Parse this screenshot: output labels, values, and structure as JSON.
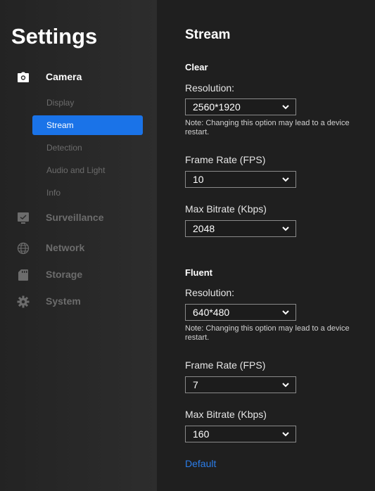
{
  "sidebar": {
    "title": "Settings",
    "camera": {
      "label": "Camera",
      "icon": "camera-icon"
    },
    "camera_items": [
      {
        "label": "Display"
      },
      {
        "label": "Stream",
        "selected": true
      },
      {
        "label": "Detection"
      },
      {
        "label": "Audio and Light"
      },
      {
        "label": "Info"
      }
    ],
    "surveillance": {
      "label": "Surveillance",
      "icon": "monitor-icon"
    },
    "network": {
      "label": "Network",
      "icon": "globe-icon"
    },
    "storage": {
      "label": "Storage",
      "icon": "sd-card-icon"
    },
    "system": {
      "label": "System",
      "icon": "gear-icon"
    }
  },
  "main": {
    "title": "Stream",
    "clear": {
      "title": "Clear",
      "resolution_label": "Resolution:",
      "resolution_value": "2560*1920",
      "note": "Note: Changing this option may lead to a device restart.",
      "framerate_label": "Frame Rate (FPS)",
      "framerate_value": "10",
      "bitrate_label": "Max Bitrate (Kbps)",
      "bitrate_value": "2048"
    },
    "fluent": {
      "title": "Fluent",
      "resolution_label": "Resolution:",
      "resolution_value": "640*480",
      "note": "Note: Changing this option may lead to a device restart.",
      "framerate_label": "Frame Rate (FPS)",
      "framerate_value": "7",
      "bitrate_label": "Max Bitrate (Kbps)",
      "bitrate_value": "160"
    },
    "default_link": "Default"
  },
  "colors": {
    "accent": "#1a73e8",
    "link": "#2b7de9",
    "sidebar_bg": "#2a2a2a",
    "main_bg": "#1f1f1f",
    "muted_text": "#6c6c6c"
  }
}
